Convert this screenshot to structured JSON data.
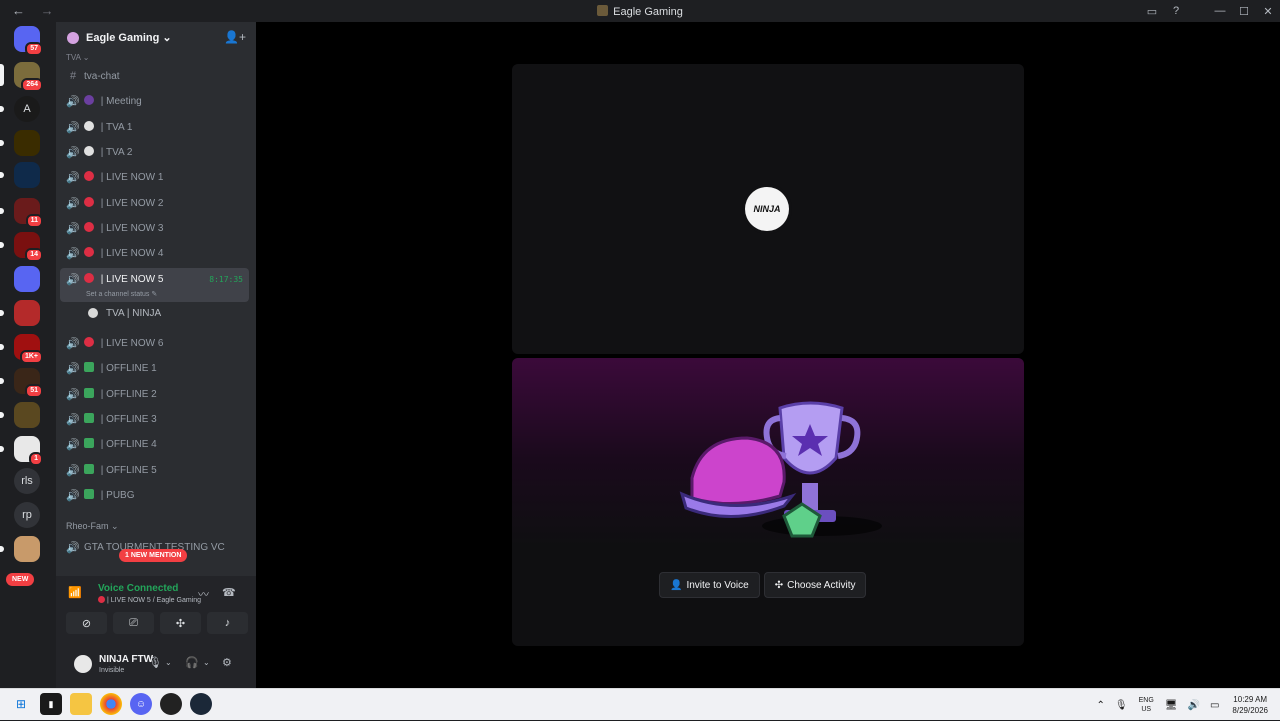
{
  "window": {
    "title": "Eagle Gaming",
    "nav_back": "←",
    "nav_forward": "→",
    "inbox_icon": "inbox-icon",
    "help_icon": "help-icon",
    "minimize": "—",
    "maximize": "☐",
    "close": "✕"
  },
  "guilds": [
    {
      "name": "discord-home",
      "badge": "57",
      "color": "#5865f2",
      "text": ""
    },
    {
      "name": "server-1",
      "badge": "264",
      "color": "#7b6c3c",
      "text": ""
    },
    {
      "name": "server-apex",
      "badge": "",
      "color": "#1a1a1a",
      "text": "A"
    },
    {
      "name": "server-yellow",
      "badge": "",
      "color": "#3a2c00",
      "text": ""
    },
    {
      "name": "server-blue-shield",
      "badge": "",
      "color": "#0f2a4a",
      "text": ""
    },
    {
      "name": "server-red-avatar",
      "badge": "11",
      "color": "#6a1b1b",
      "text": ""
    },
    {
      "name": "server-red-2",
      "badge": "14",
      "color": "#7a1010",
      "text": ""
    },
    {
      "name": "folder",
      "badge": "",
      "color": "#5865f2",
      "text": ""
    },
    {
      "name": "server-red-3",
      "badge": "",
      "color": "#b42a2a",
      "text": ""
    },
    {
      "name": "server-red-4",
      "badge": "1K+",
      "color": "#a01010",
      "text": ""
    },
    {
      "name": "server-char",
      "badge": "51",
      "color": "#3a2618",
      "text": ""
    },
    {
      "name": "server-gold",
      "badge": "",
      "color": "#5a4820",
      "text": ""
    },
    {
      "name": "server-ninja",
      "badge": "1",
      "color": "#e8e8e8",
      "text": ""
    },
    {
      "name": "server-rls",
      "badge": "",
      "color": "#313338",
      "text": "rls"
    },
    {
      "name": "server-rp",
      "badge": "",
      "color": "#313338",
      "text": "rp"
    },
    {
      "name": "server-last",
      "badge": "",
      "color": "#c89a6a",
      "text": ""
    }
  ],
  "new_pill": "NEW",
  "server": {
    "name": "Eagle Gaming",
    "chevron": "⌄",
    "category_top": "TVA ⌄"
  },
  "channels": [
    {
      "icon": "#",
      "emoji_color": "",
      "label": "tva-chat"
    },
    {
      "icon": "🔊",
      "emoji_color": "#6b3fa0",
      "label": " | Meeting"
    },
    {
      "icon": "🔊",
      "emoji_color": "#e0e0e0",
      "label": " | TVA 1"
    },
    {
      "icon": "🔊",
      "emoji_color": "#e0e0e0",
      "label": " | TVA 2"
    },
    {
      "icon": "🔊",
      "emoji_color": "#dd2e44",
      "label": " | LIVE NOW 1"
    },
    {
      "icon": "🔊",
      "emoji_color": "#dd2e44",
      "label": " | LIVE NOW 2"
    },
    {
      "icon": "🔊",
      "emoji_color": "#dd2e44",
      "label": " | LIVE NOW 3"
    },
    {
      "icon": "🔊",
      "emoji_color": "#dd2e44",
      "label": " | LIVE NOW 4"
    }
  ],
  "active_channel": {
    "emoji_color": "#dd2e44",
    "label": " | LIVE NOW 5",
    "timer": "8:17:35",
    "status": "Set a channel status ✎"
  },
  "voice_member": "TVA | NINJA",
  "channels_after": [
    {
      "emoji_color": "#dd2e44",
      "label": " | LIVE NOW 6"
    },
    {
      "emoji_color": "#3ba55c",
      "label": " | OFFLINE 1"
    },
    {
      "emoji_color": "#3ba55c",
      "label": " | OFFLINE 2"
    },
    {
      "emoji_color": "#3ba55c",
      "label": " | OFFLINE 3"
    },
    {
      "emoji_color": "#3ba55c",
      "label": " | OFFLINE 4"
    },
    {
      "emoji_color": "#3ba55c",
      "label": " | OFFLINE 5"
    },
    {
      "emoji_color": "#3ba55c",
      "label": " | PUBG"
    }
  ],
  "category2": "Rheo-Fam ⌄",
  "gta_channel": "GTA TOURMENT TESTING VC",
  "mention_pill": "1 NEW MENTION",
  "voice": {
    "status": "Voice Connected",
    "location": "| LIVE NOW 5 / Eagle Gaming"
  },
  "user": {
    "name": "NINJA FTW",
    "status": "Invisible"
  },
  "stage": {
    "avatar_text": "NINJA",
    "invite_label": "Invite to Voice",
    "activity_label": "Choose Activity"
  },
  "taskbar": {
    "lang_top": "ENG",
    "lang_bottom": "US",
    "time": "10:29 AM",
    "date": "8/29/2026"
  }
}
